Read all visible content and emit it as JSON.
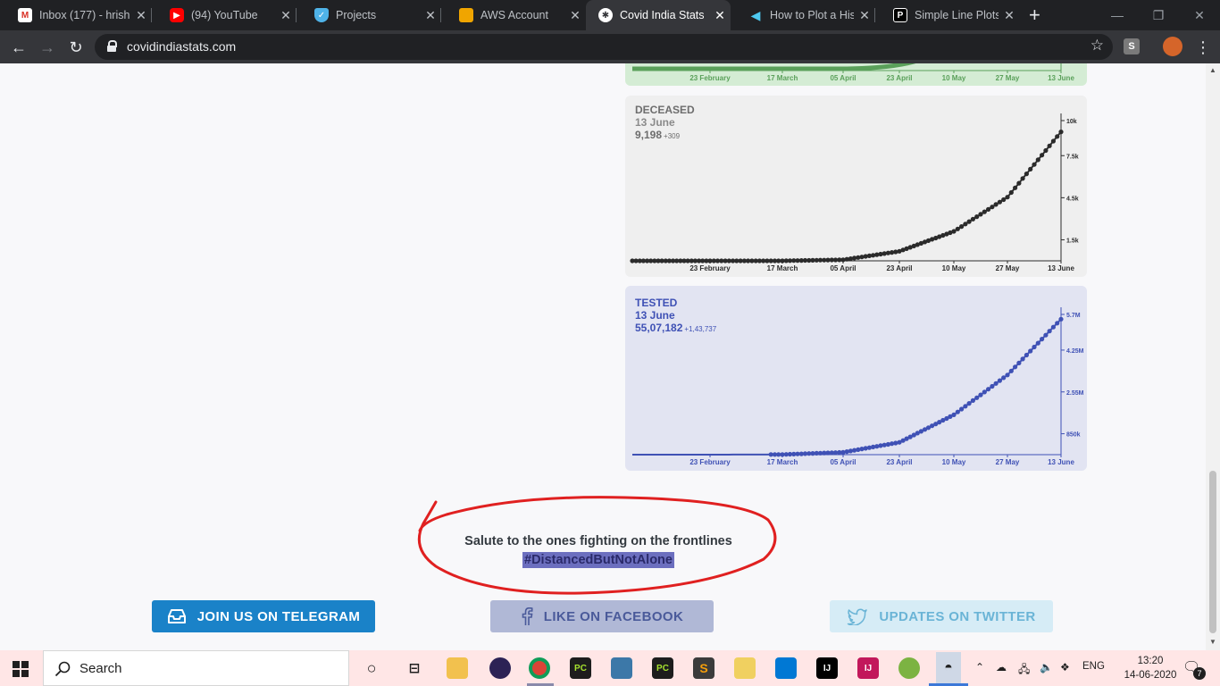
{
  "browser": {
    "tabs": [
      {
        "label": "Inbox (177) - hrish",
        "icon": "gmail-icon",
        "active": false
      },
      {
        "label": "(94) YouTube",
        "icon": "youtube-icon",
        "active": false
      },
      {
        "label": "Projects",
        "icon": "shield-icon",
        "active": false
      },
      {
        "label": "AWS Account",
        "icon": "aws-icon",
        "active": false
      },
      {
        "label": "Covid India Stats",
        "icon": "virus-icon",
        "active": true
      },
      {
        "label": "How to Plot a Hist",
        "icon": "fish-icon",
        "active": false
      },
      {
        "label": "Simple Line Plots |",
        "icon": "p-icon",
        "active": false
      }
    ],
    "url": "covidindiastats.com"
  },
  "charts": {
    "x_ticks": [
      "23 February",
      "17 March",
      "05 April",
      "23 April",
      "10 May",
      "27 May",
      "13 June"
    ],
    "confirmed_color": "#5aa05a",
    "deceased": {
      "title": "DECEASED",
      "date": "13 June",
      "value": "9,198",
      "delta": "+309",
      "y_ticks": [
        "10k",
        "7.5k",
        "4.5k",
        "1.5k"
      ],
      "color": "#2b2b2b"
    },
    "tested": {
      "title": "TESTED",
      "date": "13 June",
      "value": "55,07,182",
      "delta": "+1,43,737",
      "y_ticks": [
        "5.7M",
        "4.25M",
        "2.55M",
        "850k"
      ],
      "color": "#3f51b5"
    }
  },
  "chart_data": [
    {
      "type": "line",
      "title": "DECEASED",
      "x": [
        "23 February",
        "17 March",
        "05 April",
        "23 April",
        "10 May",
        "27 May",
        "13 June"
      ],
      "series": [
        {
          "values": [
            0,
            3,
            75,
            680,
            2100,
            4540,
            9198
          ]
        }
      ],
      "y_ticks": [
        1500,
        4500,
        7500,
        10000
      ],
      "ylim": [
        0,
        10000
      ]
    },
    {
      "type": "line",
      "title": "TESTED",
      "x": [
        "23 February",
        "17 March",
        "05 April",
        "23 April",
        "10 May",
        "27 May",
        "13 June"
      ],
      "series": [
        {
          "values": [
            0,
            6500,
            96000,
            500000,
            1620000,
            3240000,
            5507182
          ]
        }
      ],
      "y_ticks": [
        850000,
        2550000,
        4250000,
        5700000
      ],
      "ylim": [
        0,
        5700000
      ]
    }
  ],
  "salute": {
    "line1": "Salute to the ones fighting on the frontlines",
    "hashtag": "#DistancedButNotAlone"
  },
  "social": {
    "telegram": "JOIN US ON TELEGRAM",
    "facebook": "LIKE ON FACEBOOK",
    "twitter": "UPDATES ON TWITTER"
  },
  "taskbar": {
    "search_placeholder": "Search",
    "language": "ENG",
    "time": "13:20",
    "date": "14-06-2020",
    "notification_count": "7"
  }
}
